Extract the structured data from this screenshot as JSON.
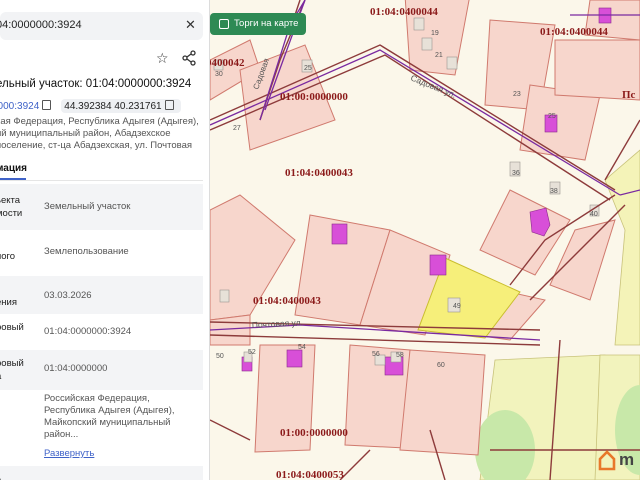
{
  "panel": {
    "search_value": "04:0000000:3924",
    "title": "ельный участок: 01:04:0000000:3924",
    "id_link": "0000:3924",
    "coords": "44.392384 40.231761",
    "address": "ий муниципальный район, Абадзехское поселение, ст-ца Абадзехская, ул. Почтовая",
    "address_top": "кая Федерация, Республика Адыгея (Адыгея),",
    "tab": "мация",
    "rows": [
      {
        "label": "ьекта\nмости",
        "value": "Земельный участок"
      },
      {
        "label": "ного",
        "value": "Землепользование"
      },
      {
        "label": "ения",
        "value": "03.03.2026"
      },
      {
        "label": "ровый",
        "value": "01:04:0000000:3924"
      },
      {
        "label": "ровый\nа",
        "value": "01:04:0000000"
      },
      {
        "label": "",
        "value": "Российская Федерация, Республика Адыгея (Адыгея), Майкопский муниципальный район..."
      },
      {
        "label": "ь",
        "value": ""
      }
    ],
    "expand_label": "Развернуть"
  },
  "map": {
    "torgi_label": "Торги на карте",
    "logo_text": "m",
    "street_labels": [
      "Садовая ул.",
      "Почтовая ул.",
      "Садовая"
    ],
    "quarter_labels": [
      "01:04:0400044",
      "01:04:0400044",
      "01:00:0000000",
      "01:04:0400043",
      "01:04:0400043",
      "01:00:0000000",
      "01:04:0400053",
      "0400042",
      "Пс"
    ],
    "house_numbers": [
      "19",
      "21",
      "25",
      "30",
      "27",
      "23",
      "25",
      "36",
      "38",
      "40",
      "49",
      "50",
      "52",
      "54",
      "56",
      "58",
      "60"
    ]
  },
  "colors": {
    "map_bg": "#fbf7ea",
    "parcel_fill": "#f7d6cc",
    "parcel_stroke": "#d07a6e",
    "selected_fill": "#f6ef7a",
    "building": "#d84fd8",
    "quarter_label": "#8b1a1a",
    "accent": "#2e8a54",
    "link": "#3f62c8"
  }
}
